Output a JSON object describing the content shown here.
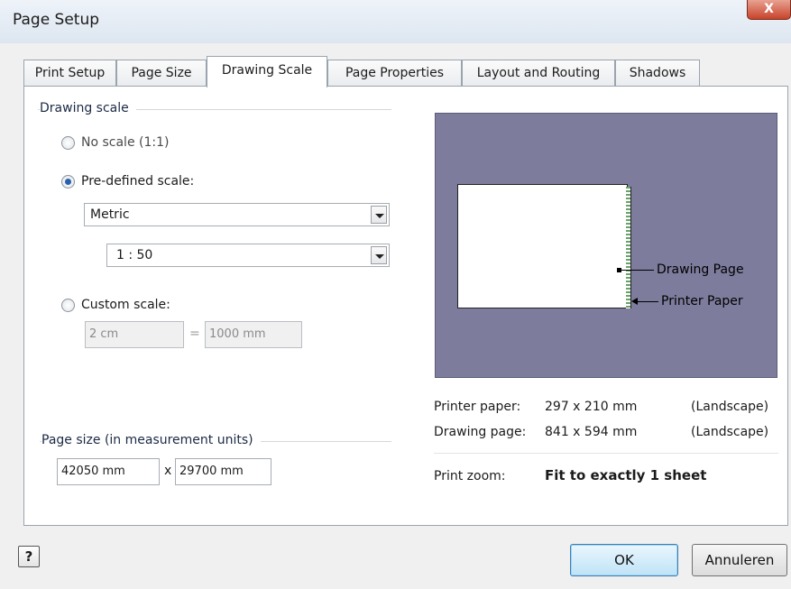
{
  "window": {
    "title": "Page Setup",
    "close_label": "X"
  },
  "tabs": [
    {
      "label": "Print Setup"
    },
    {
      "label": "Page Size"
    },
    {
      "label": "Drawing Scale"
    },
    {
      "label": "Page Properties"
    },
    {
      "label": "Layout and Routing"
    },
    {
      "label": "Shadows"
    }
  ],
  "active_tab": "Drawing Scale",
  "drawing_scale": {
    "group_label": "Drawing scale",
    "no_scale_label": "No scale (1:1)",
    "predefined_label": "Pre-defined scale:",
    "selected_option": "predefined",
    "predefined_category": "Metric",
    "predefined_ratio": "1 : 50",
    "custom_label": "Custom scale:",
    "custom_left": "2 cm",
    "custom_equals": "=",
    "custom_right": "1000 mm"
  },
  "page_size": {
    "group_label": "Page size (in measurement units)",
    "width": "42050 mm",
    "times": "x",
    "height": "29700 mm"
  },
  "preview": {
    "drawing_page_label": "Drawing Page",
    "printer_paper_label": "Printer Paper",
    "background_color": "#7d7c9d"
  },
  "info": {
    "printer_paper_label": "Printer paper:",
    "printer_paper_value": "297 x 210 mm",
    "printer_paper_orientation": "(Landscape)",
    "drawing_page_label": "Drawing page:",
    "drawing_page_value": "841 x 594 mm",
    "drawing_page_orientation": "(Landscape)",
    "print_zoom_label": "Print zoom:",
    "print_zoom_value": "Fit to exactly 1 sheet"
  },
  "buttons": {
    "help": "?",
    "ok": "OK",
    "cancel": "Annuleren"
  },
  "colors": {
    "accent": "#2a5fb0",
    "default_button": "#bfe3f7",
    "close": "#c8432a"
  }
}
